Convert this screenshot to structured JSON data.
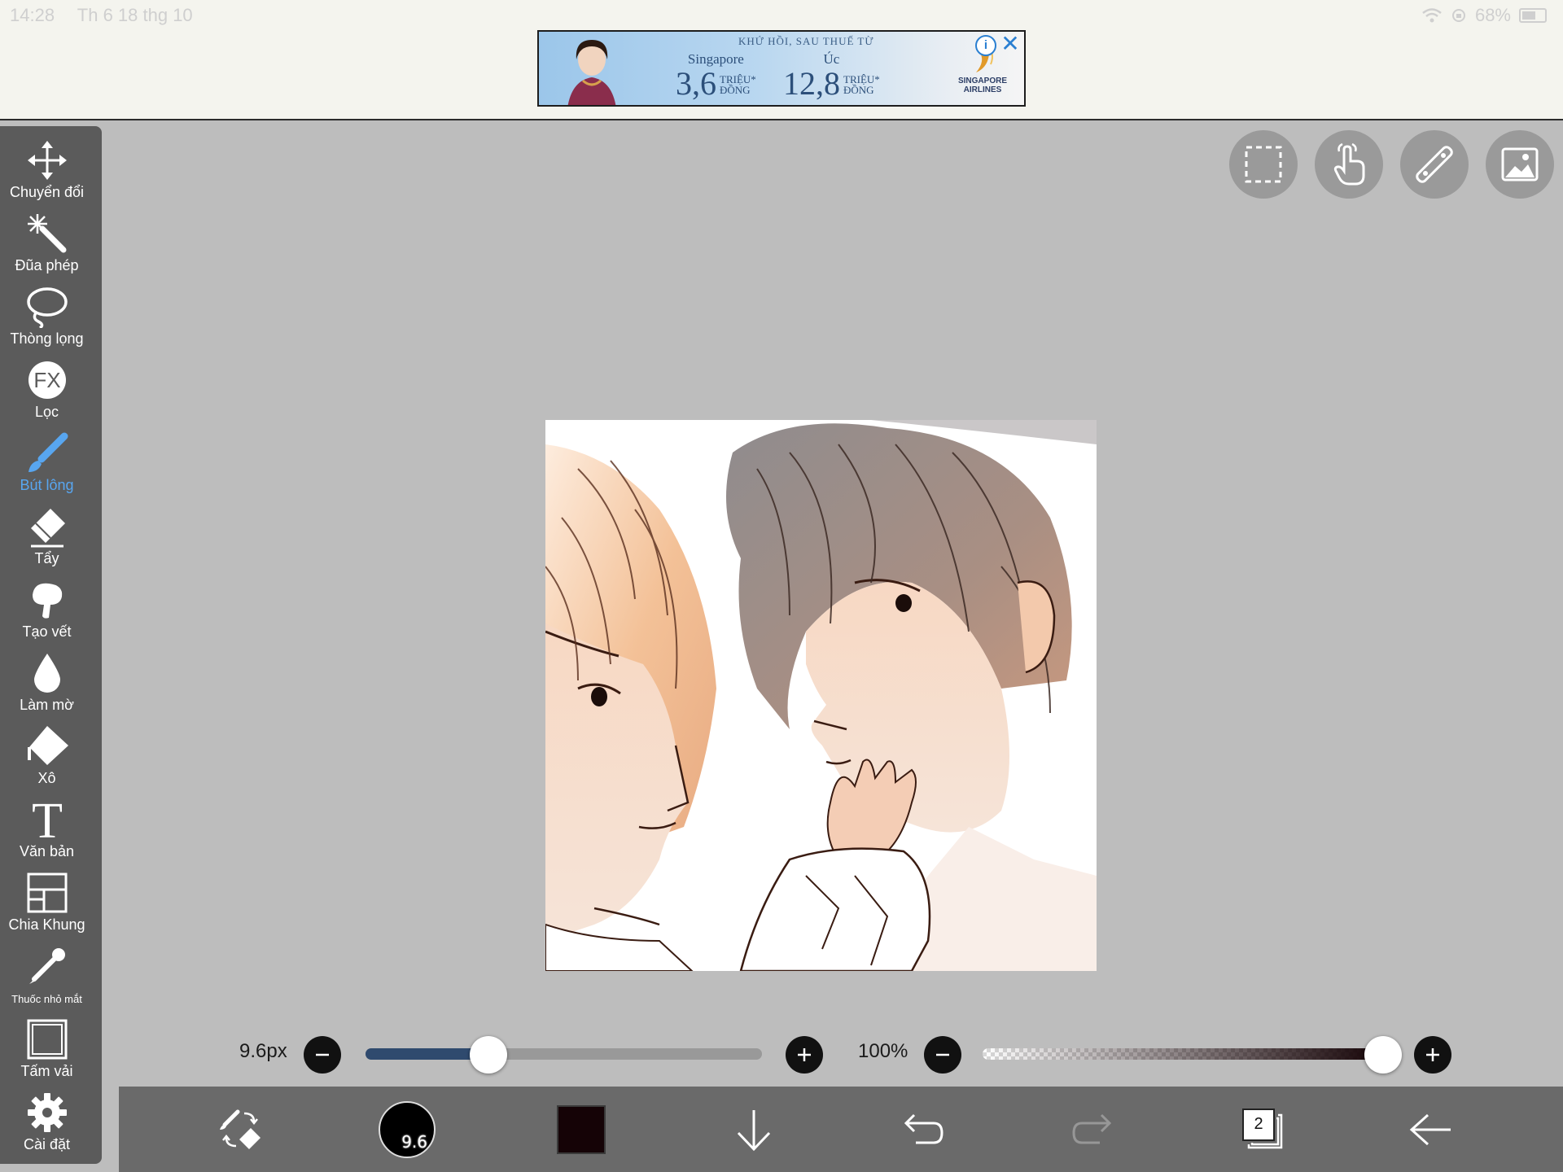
{
  "status_bar": {
    "time": "14:28",
    "date": "Th 6 18 thg 10",
    "battery": "68%"
  },
  "ad": {
    "headline": "KHỨ HỒI, SAU THUẾ TỪ",
    "offers": [
      {
        "destination": "Singapore",
        "price": "3,6",
        "unit_top": "TRIỆU*",
        "unit_bottom": "ĐỒNG"
      },
      {
        "destination": "Úc",
        "price": "12,8",
        "unit_top": "TRIỆU*",
        "unit_bottom": "ĐỒNG"
      }
    ],
    "brand_line1": "SINGAPORE",
    "brand_line2": "AIRLINES",
    "info_label": "i",
    "close_label": "✕"
  },
  "tools": [
    {
      "name": "transform",
      "label": "Chuyển đổi",
      "icon": "move-arrows-icon"
    },
    {
      "name": "magic-wand",
      "label": "Đũa phép",
      "icon": "magic-wand-icon"
    },
    {
      "name": "lasso",
      "label": "Thòng lọng",
      "icon": "lasso-icon"
    },
    {
      "name": "filter",
      "label": "Lọc",
      "icon": "fx-icon"
    },
    {
      "name": "brush",
      "label": "Bút lông",
      "icon": "brush-icon",
      "active": true
    },
    {
      "name": "eraser",
      "label": "Tẩy",
      "icon": "eraser-icon"
    },
    {
      "name": "smudge",
      "label": "Tạo vết",
      "icon": "smudge-icon"
    },
    {
      "name": "blur",
      "label": "Làm mờ",
      "icon": "drop-icon"
    },
    {
      "name": "bucket",
      "label": "Xô",
      "icon": "bucket-icon"
    },
    {
      "name": "text",
      "label": "Văn bản",
      "icon": "text-icon"
    },
    {
      "name": "frame-divider",
      "label": "Chia Khung",
      "icon": "frame-divider-icon"
    },
    {
      "name": "eyedropper",
      "label": "Thuốc nhỏ mắt",
      "icon": "eyedropper-icon"
    },
    {
      "name": "canvas",
      "label": "Tấm vải",
      "icon": "canvas-icon"
    },
    {
      "name": "settings",
      "label": "Cài đặt",
      "icon": "gear-icon"
    }
  ],
  "brush_size": {
    "label": "9.6px",
    "fraction": 0.31
  },
  "opacity": {
    "label": "100%",
    "fraction": 1.0
  },
  "bottom_bar": {
    "brush_preview_value": "9.6",
    "color": "#150306",
    "layer_count": "2"
  },
  "colors": {
    "accent": "#58a6f0",
    "panel": "#5b5b5b",
    "slider_fill": "#2f4a6e"
  }
}
